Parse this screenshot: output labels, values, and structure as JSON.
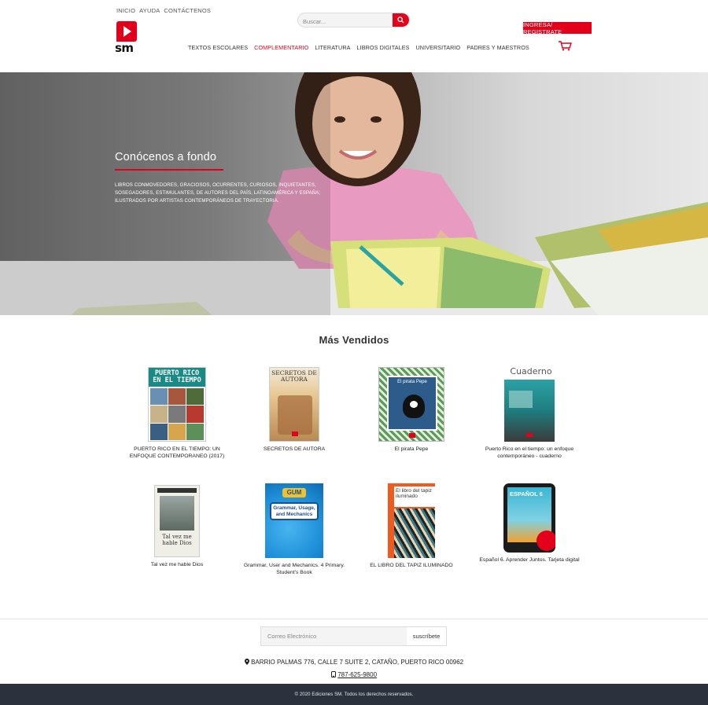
{
  "header": {
    "toplinks": [
      "INICIO",
      "AYUDA",
      "CONTÁCTENOS"
    ],
    "logo_text": "sm",
    "search_placeholder": "Buscar...",
    "nav": [
      "TEXTOS ESCOLARES",
      "COMPLEMENTARIO",
      "LITERATURA",
      "LIBROS DIGITALES",
      "UNIVERSITARIO",
      "PADRES Y MAESTROS"
    ],
    "nav_active": "COMPLEMENTARIO",
    "login_label": "INGRESA/ REGISTRATE"
  },
  "hero": {
    "title": "Conócenos a fondo",
    "description": "LIBROS CONMOVEDORES, GRACIOSOS, OCURRENTES, CURIOSOS, INQUIETANTES, SOSEGADORES, ESTIMULANTES, DE AUTORES DEL PAÍS, LATINOAMÉRICA Y ESPAÑA; ILUSTRADOS POR ARTISTAS CONTEMPORÁNEOS DE TRAYECTORIA."
  },
  "best_sellers": {
    "title": "Más Vendidos",
    "books": [
      {
        "title": "PUERTO RICO EN EL TIEMPO: UN ENFOQUE CONTEMPORANEO (2017)",
        "cover_text": "PUERTO RICO EN EL TIEMPO",
        "cover_color": "#1a8a86"
      },
      {
        "title": "SECRETOS DE AUTORA",
        "cover_text": "SECRETOS DE AUTORA",
        "cover_color": "#c89b5a"
      },
      {
        "title": "El pirata Pepe",
        "cover_text": "El pirata Pepe",
        "cover_color": "#2a6b3a"
      },
      {
        "title": "Puerto Rico en el tiempo: un enfoque contemporáneo - cuaderno",
        "cover_text": "Cuaderno",
        "cover_color": "#2aa2a6"
      },
      {
        "title": "Tal vez me hable Dios",
        "cover_text": "Tal vez me hable Dios",
        "cover_color": "#efefe8"
      },
      {
        "title": "Grammar, User and Mechanics. 4 Primary. Student's Book",
        "cover_text": "Grammar, Usage, and Mechanics",
        "cover_color": "#1d8fd8"
      },
      {
        "title": "EL LIBRO DEL TAPIZ ILUMINADO",
        "cover_text": "El libro del tapiz iluminado",
        "cover_color": "#f05a1e"
      },
      {
        "title": "Español 6. Aprender Juntos. Tarjeta digital",
        "cover_text": "ESPAÑOL 6",
        "cover_color": "#3ab7d4"
      }
    ]
  },
  "footer": {
    "email_placeholder": "Correo Electrónico",
    "subscribe_label": "suscríbete",
    "address": "BARRIO PALMAS 776, CALLE 7 SUITE 2, CATAÑO, PUERTO RICO 00962",
    "phone": "787-625-9800",
    "copyright": "© 2020 Ediciones SM. Todos los derechos reservados."
  },
  "colors": {
    "brand": "#e2001a",
    "footer_bg": "#2b323d"
  }
}
